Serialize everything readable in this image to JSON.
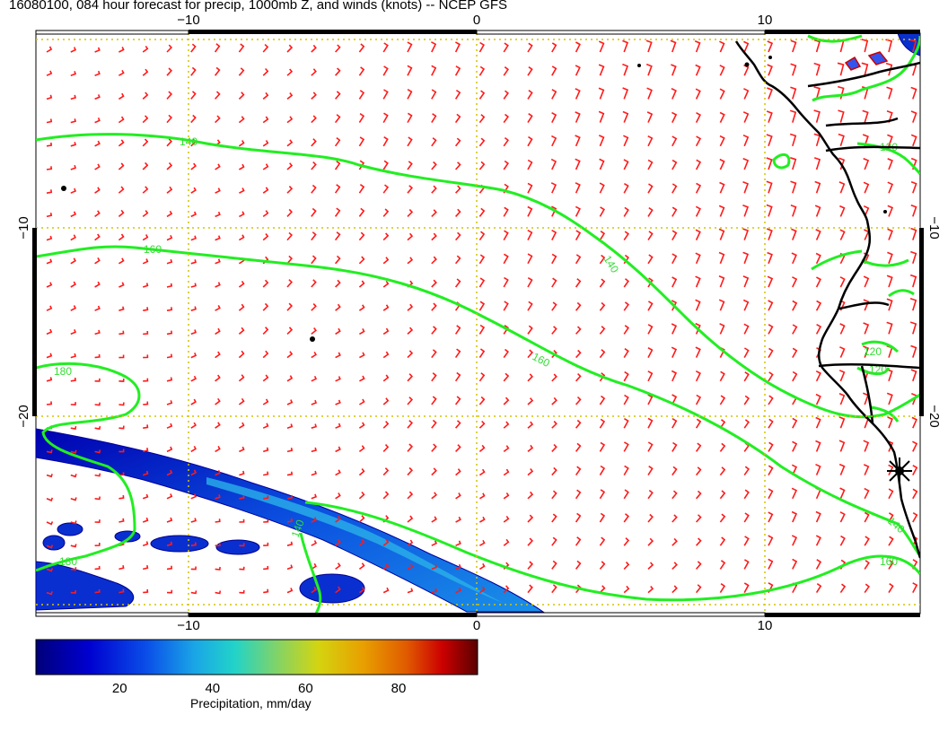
{
  "title": "16080100, 084 hour forecast for precip, 1000mb Z, and winds (knots) -- NCEP GFS",
  "axes": {
    "x_ticks_top": [
      "−10",
      "0",
      "10"
    ],
    "x_ticks_bottom": [
      "−10",
      "0",
      "10"
    ],
    "y_ticks_left": [
      "−10",
      "−20"
    ],
    "y_ticks_right": [
      "−10",
      "−20"
    ]
  },
  "contours": {
    "color": "#22ee22",
    "labels": [
      "140",
      "160",
      "140",
      "160",
      "180",
      "180",
      "140",
      "120",
      "120",
      "120",
      "140",
      "160",
      "140"
    ],
    "levels": [
      120,
      140,
      160,
      180
    ]
  },
  "wind_barbs": {
    "color": "#ff1a1a",
    "units": "knots"
  },
  "precip_colors": [
    "#00007a",
    "#0000cc",
    "#0a4ee8",
    "#1aa6e6",
    "#22d3c8",
    "#8fd35a",
    "#d4d410",
    "#e8a000",
    "#e05a00",
    "#cc0000",
    "#6a0000"
  ],
  "colorbar": {
    "ticks": [
      "20",
      "40",
      "60",
      "80"
    ],
    "label": "Precipitation, mm/day",
    "tick_values": [
      20,
      40,
      60,
      80
    ],
    "range": [
      2,
      97
    ]
  },
  "marker": "storm-asterisk"
}
